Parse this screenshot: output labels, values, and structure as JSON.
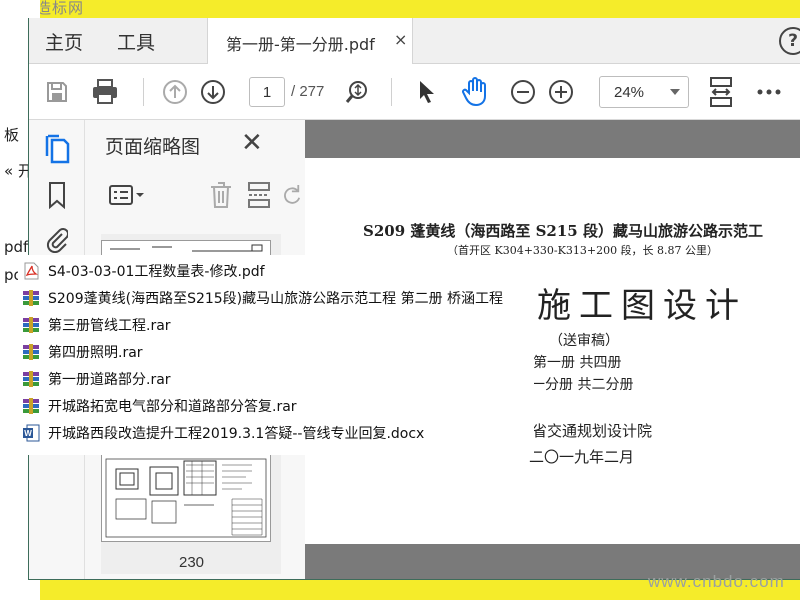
{
  "watermark": {
    "top_left": "季图造标网",
    "bottom_right": "www.cnbdo.com"
  },
  "background_app": {
    "left_texts": [
      "板",
      "« 开",
      "pdf",
      "po"
    ]
  },
  "tabs": {
    "home": "主页",
    "tools": "工具",
    "document": "第一册-第一分册.pdf",
    "close_symbol": "×"
  },
  "toolbar": {
    "current_page": "1",
    "total_pages": "/ 277",
    "zoom": "24%"
  },
  "thumbnail_panel": {
    "title": "页面缩略图",
    "page_number": "230"
  },
  "document": {
    "title_line": "S209 蓬黄线（海西路至 S215 段）藏马山旅游公路示范工",
    "subtitle_line": "（首开区 K304+330-K313+200 段，长 8.87 公里）",
    "heading": "施工图设计",
    "review": "（送审稿）",
    "volume": "第一册  共四册",
    "sub_volume": "第一分册  共二分册",
    "organization": "东省交通规划设计院",
    "date": "二〇一九年二月"
  },
  "file_list": [
    {
      "name": "S4-03-03-01工程数量表-修改.pdf",
      "type": "pdf"
    },
    {
      "name": "S209蓬黄线(海西路至S215段)藏马山旅游公路示范工程 第二册 桥涵工程",
      "type": "rar"
    },
    {
      "name": "第三册管线工程.rar",
      "type": "rar"
    },
    {
      "name": "第四册照明.rar",
      "type": "rar"
    },
    {
      "name": "第一册道路部分.rar",
      "type": "rar"
    },
    {
      "name": "开城路拓宽电气部分和道路部分答复.rar",
      "type": "rar"
    },
    {
      "name": "开城路西段改造提升工程2019.3.1答疑--管线专业回复.docx",
      "type": "docx"
    }
  ],
  "colors": {
    "background_yellow": "#f5ec2a",
    "accent_blue": "#1473e6",
    "toolbar_gray": "#f0f0f0"
  }
}
